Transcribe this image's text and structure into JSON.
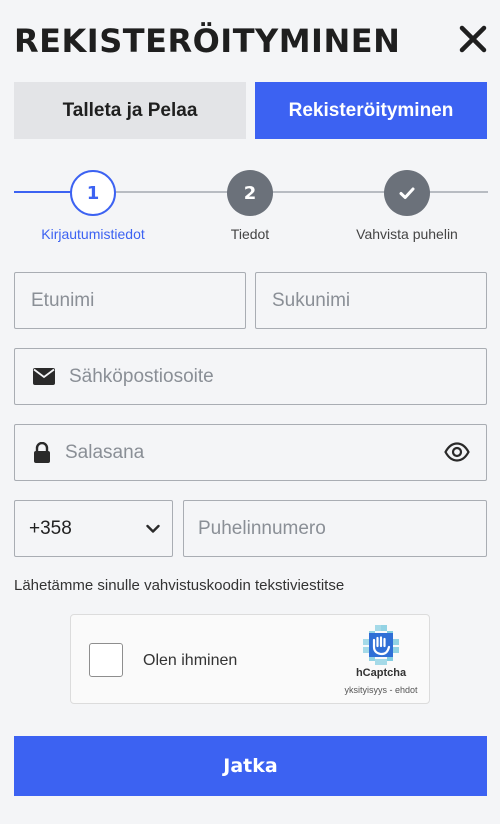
{
  "header": {
    "title": "REKISTERÖITYMINEN"
  },
  "tabs": [
    {
      "label": "Talleta ja Pelaa",
      "active": false
    },
    {
      "label": "Rekisteröityminen",
      "active": true
    }
  ],
  "stepper": {
    "steps": [
      {
        "number": "1",
        "label": "Kirjautumistiedot",
        "state": "active"
      },
      {
        "number": "2",
        "label": "Tiedot",
        "state": "pending"
      },
      {
        "number": "",
        "icon": "check-icon",
        "label": "Vahvista puhelin",
        "state": "pending"
      }
    ]
  },
  "form": {
    "first_name": {
      "placeholder": "Etunimi",
      "value": ""
    },
    "last_name": {
      "placeholder": "Sukunimi",
      "value": ""
    },
    "email": {
      "placeholder": "Sähköpostiosoite",
      "value": "",
      "icon": "envelope-icon"
    },
    "password": {
      "placeholder": "Salasana",
      "value": "",
      "icon": "lock-icon",
      "toggle_icon": "eye-icon"
    },
    "country_code": {
      "value": "+358"
    },
    "phone": {
      "placeholder": "Puhelinnumero",
      "value": ""
    },
    "hint": "Lähetämme sinulle vahvistuskoodin tekstiviestitse"
  },
  "captcha": {
    "label": "Olen ihminen",
    "brand": "hCaptcha",
    "links": "yksityisyys - ehdot"
  },
  "submit": {
    "label": "Jatka"
  },
  "colors": {
    "accent": "#3c62f2",
    "inactive_step": "#6b717a",
    "background": "#f4f5f7"
  }
}
